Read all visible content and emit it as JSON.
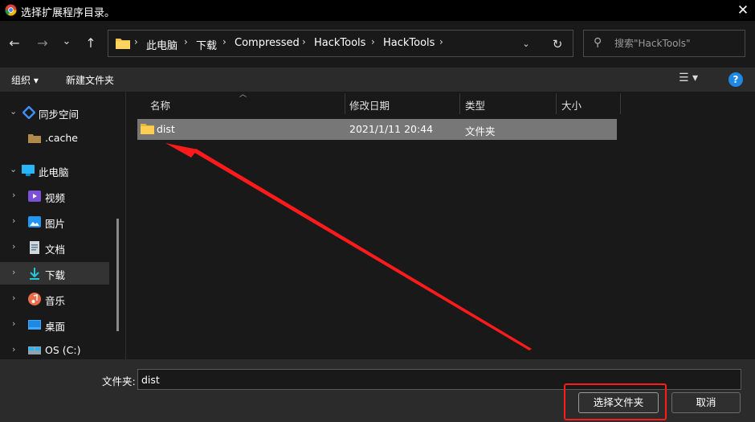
{
  "titlebar": {
    "title": "选择扩展程序目录。",
    "close": "✕"
  },
  "nav": {
    "back": "←",
    "forward": "→",
    "recent": "⌄",
    "up": "↑"
  },
  "address": {
    "crumbs": [
      "此电脑",
      "下载",
      "Compressed",
      "HackTools",
      "HackTools"
    ],
    "separator": "›",
    "dropdown": "⌄",
    "refresh": "↻"
  },
  "search": {
    "placeholder": "搜索\"HackTools\"",
    "icon": "⚲"
  },
  "toolbar": {
    "organize": "组织 ▾",
    "new_folder": "新建文件夹",
    "view": "☰ ▾",
    "help": "?"
  },
  "sidebar": {
    "items": [
      {
        "label": "同步空间",
        "icon": "sync-space-icon",
        "chevron": "⌄"
      },
      {
        "label": ".cache",
        "icon": "folder-icon",
        "chevron": ""
      },
      {
        "label": "此电脑",
        "icon": "computer-icon",
        "chevron": "⌄"
      },
      {
        "label": "视频",
        "icon": "video-icon",
        "chevron": "›"
      },
      {
        "label": "图片",
        "icon": "pictures-icon",
        "chevron": "›"
      },
      {
        "label": "文档",
        "icon": "documents-icon",
        "chevron": "›"
      },
      {
        "label": "下载",
        "icon": "download-icon",
        "chevron": "›"
      },
      {
        "label": "音乐",
        "icon": "music-icon",
        "chevron": "›"
      },
      {
        "label": "桌面",
        "icon": "desktop-icon",
        "chevron": "›"
      },
      {
        "label": "OS (C:)",
        "icon": "drive-icon",
        "chevron": "›"
      }
    ]
  },
  "filelist": {
    "headers": {
      "name": "名称",
      "modified": "修改日期",
      "type": "类型",
      "size": "大小"
    },
    "rows": [
      {
        "name": "dist",
        "modified": "2021/1/11 20:44",
        "type": "文件夹",
        "size": ""
      }
    ]
  },
  "bottom": {
    "folder_label": "文件夹:",
    "folder_value": "dist",
    "select_button": "选择文件夹",
    "cancel_button": "取消"
  },
  "colors": {
    "annotation": "#ff1b1b",
    "selected_row": "#777777",
    "help": "#1e88e5"
  }
}
